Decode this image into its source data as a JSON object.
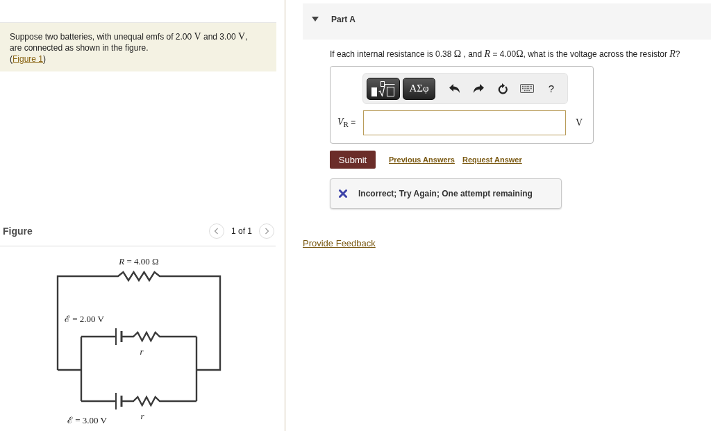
{
  "problem": {
    "segments": [
      {
        "kind": "text",
        "text": "Suppose two batteries, with unequal emfs of 2.00 "
      },
      {
        "kind": "math",
        "text": "V"
      },
      {
        "kind": "text",
        "text": " and 3.00 "
      },
      {
        "kind": "math",
        "text": "V"
      },
      {
        "kind": "text",
        "text": ", are connected as shown in the figure."
      }
    ],
    "figure_link": {
      "open": "(",
      "label": "Figure 1",
      "close": ")"
    }
  },
  "figure": {
    "title": "Figure",
    "pager": "1 of 1",
    "circuit": {
      "resistor_label": "*R* = 4.00 Ω",
      "branches": [
        {
          "emf": "ℰ = 2.00 V",
          "r_label": "r"
        },
        {
          "emf": "ℰ = 3.00 V",
          "r_label": "r"
        }
      ]
    }
  },
  "part": {
    "title": "Part A",
    "expanded": true
  },
  "question": {
    "segments": [
      {
        "kind": "text",
        "text": "If each internal resistance is 0.38 "
      },
      {
        "kind": "math",
        "text": "Ω"
      },
      {
        "kind": "text",
        "text": " , and "
      },
      {
        "kind": "var",
        "text": "R"
      },
      {
        "kind": "text",
        "text": " = 4.00"
      },
      {
        "kind": "math",
        "text": "Ω"
      },
      {
        "kind": "text",
        "text": ", what is the voltage across the resistor "
      },
      {
        "kind": "var",
        "text": "R"
      },
      {
        "kind": "text",
        "text": "?"
      }
    ]
  },
  "answer": {
    "toolbar": [
      {
        "kind": "templates"
      },
      {
        "kind": "symbols",
        "label": "ΑΣφ"
      },
      {
        "kind": "undo"
      },
      {
        "kind": "redo"
      },
      {
        "kind": "reset"
      },
      {
        "kind": "keyboard"
      },
      {
        "kind": "help",
        "label": "?"
      }
    ],
    "label": "*V*$_{R}$ =",
    "unit": "V"
  },
  "actions": {
    "submit": "Submit",
    "links": [
      "Previous Answers",
      "Request Answer"
    ]
  },
  "feedback": {
    "correct": false,
    "message": "Incorrect; Try Again; One attempt remaining"
  },
  "provide_feedback": "Provide Feedback"
}
